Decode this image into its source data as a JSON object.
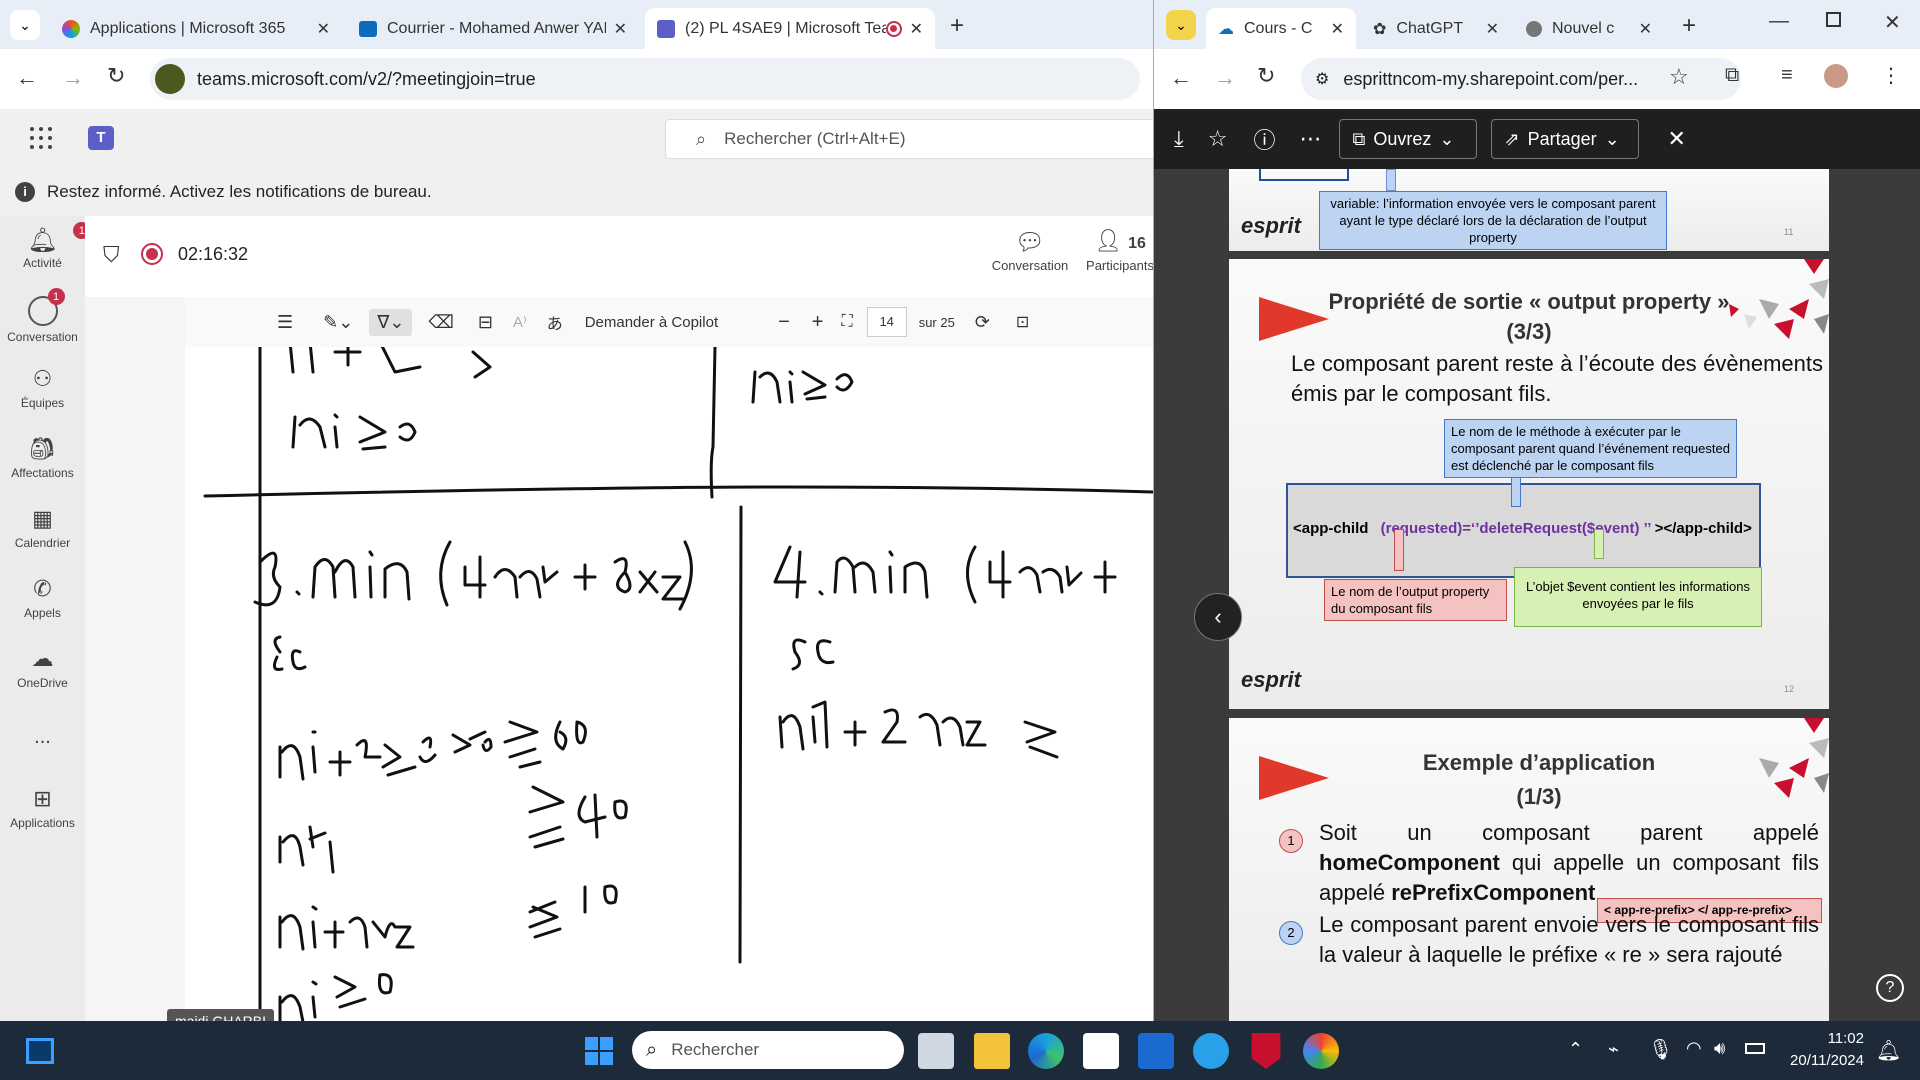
{
  "left_browser": {
    "tabs": [
      {
        "title": "Applications | Microsoft 365"
      },
      {
        "title": "Courrier - Mohamed Anwer YAI"
      },
      {
        "title": "(2) PL 4SAE9 | Microsoft Tea"
      }
    ],
    "url": "teams.microsoft.com/v2/?meetingjoin=true"
  },
  "teams": {
    "search_placeholder": "Rechercher (Ctrl+Alt+E)",
    "notification": "Restez informé. Activez les notifications de bureau.",
    "rail": [
      {
        "label": "Activité",
        "icon": "bell-icon",
        "badge": "1"
      },
      {
        "label": "Conversation",
        "icon": "chat-icon",
        "badge": "1"
      },
      {
        "label": "Équipes",
        "icon": "teams-icon"
      },
      {
        "label": "Affectations",
        "icon": "assignments-icon"
      },
      {
        "label": "Calendrier",
        "icon": "calendar-icon"
      },
      {
        "label": "Appels",
        "icon": "phone-icon"
      },
      {
        "label": "OneDrive",
        "icon": "cloud-icon"
      },
      {
        "label": "...",
        "icon": "more-icon"
      },
      {
        "label": "Applications",
        "icon": "add-apps-icon"
      }
    ],
    "meeting": {
      "timer": "02:16:32",
      "conversation_label": "Conversation",
      "participants_label": "Participants",
      "participants_count": "16",
      "presenter_name": "majdi GHARBI"
    },
    "pdf_toolbar": {
      "copilot": "Demander à Copilot",
      "page": "14",
      "of_pages": "sur 25"
    }
  },
  "right_browser": {
    "tabs": [
      {
        "title": "Cours - C"
      },
      {
        "title": "ChatGPT"
      },
      {
        "title": "Nouvel c"
      }
    ],
    "url": "esprittncom-my.sharepoint.com/per...",
    "pdf_bar": {
      "open_label": "Ouvrez",
      "share_label": "Partager"
    },
    "slides": {
      "slide11_note": "variable: l’information envoyée  vers le composant parent ayant le type déclaré lors de la déclaration de l’output property",
      "slide11_num": "11",
      "slide12_title": "Propriété de sortie « output property »",
      "slide12_sub": "(3/3)",
      "slide12_text": "Le composant parent reste à l’écoute des évènements émis par le composant fils.",
      "slide12_box_top": "Le nom de le méthode  à exécuter par le composant parent quand l’événement requested est déclenché par le composant fils",
      "code_open": "<app-child",
      "code_binding": "(requested)=‘’deleteRequest($event) ’’",
      "code_close": "></app-child>",
      "box_left": "Le nom de l’output property du composant fils",
      "box_right": "L’objet $event contient les informations envoyées par le fils",
      "slide12_num": "12",
      "slide13_title": "Exemple d’application",
      "slide13_sub": "(1/3)",
      "item1_a": "Soit un composant parent appelé",
      "item1_b": "homeComponent",
      "item1_c": "qui appelle un composant fils appelé",
      "item1_d": "rePrefixComponent",
      "item1_tag": "< app-re-prefix> </ app-re-prefix>",
      "item2": "Le composant parent envoie vers le composant fils la valeur à laquelle le préfixe « re » sera rajouté",
      "logo": "esprit"
    }
  },
  "taskbar": {
    "search": "Rechercher",
    "time": "11:02",
    "date": "20/11/2024"
  },
  "colors": {
    "teams_purple": "#5b5fc7",
    "record_red": "#c4314b",
    "esprit_red": "#e2382c"
  }
}
